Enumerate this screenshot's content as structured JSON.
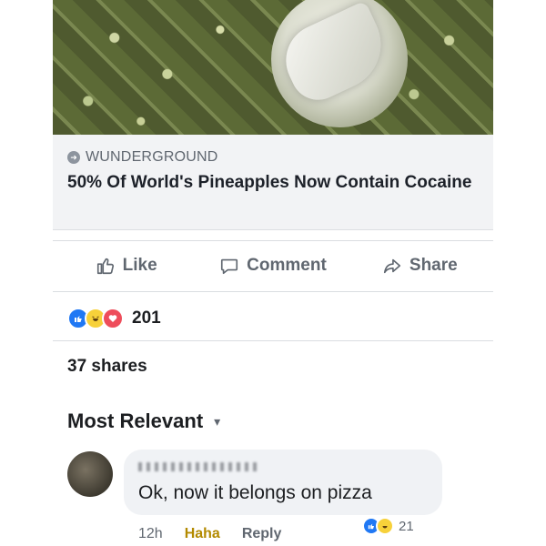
{
  "article": {
    "source": "WUNDERGROUND",
    "headline": "50% Of World's Pineapples Now Contain Cocaine"
  },
  "actions": {
    "like": "Like",
    "comment": "Comment",
    "share": "Share"
  },
  "reactions": {
    "icons": [
      "like-icon",
      "haha-icon",
      "love-icon"
    ],
    "count": "201"
  },
  "shares": "37 shares",
  "sort": {
    "label": "Most Relevant"
  },
  "comment": {
    "text": "Ok, now it belongs on pizza",
    "time": "12h",
    "reaction_label": "Haha",
    "reply_label": "Reply",
    "reaction_count": "21"
  },
  "colors": {
    "like": "#2078f4",
    "haha": "#f7d13a",
    "love": "#ee4d5b",
    "secondary_text": "#606770"
  }
}
